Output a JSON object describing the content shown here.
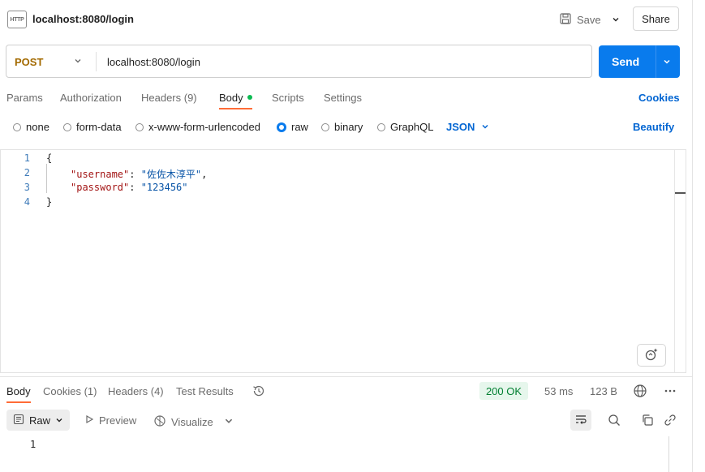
{
  "header": {
    "icon_text": "HTTP",
    "title": "localhost:8080/login",
    "save_label": "Save",
    "share_label": "Share"
  },
  "request": {
    "method": "POST",
    "url": "localhost:8080/login",
    "send_label": "Send"
  },
  "request_tabs": {
    "params": "Params",
    "authorization": "Authorization",
    "headers": "Headers (9)",
    "body": "Body",
    "scripts": "Scripts",
    "settings": "Settings",
    "cookies": "Cookies"
  },
  "body_types": {
    "none": "none",
    "form_data": "form-data",
    "urlencoded": "x-www-form-urlencoded",
    "raw": "raw",
    "binary": "binary",
    "graphql": "GraphQL",
    "format": "JSON",
    "beautify": "Beautify",
    "selected": "raw"
  },
  "editor": {
    "lines": [
      {
        "n": "1",
        "text": "{"
      },
      {
        "n": "2",
        "key": "\"username\"",
        "sep": ": ",
        "value": "\"佐佐木淳平\"",
        "tail": ","
      },
      {
        "n": "3",
        "key": "\"password\"",
        "sep": ": ",
        "value": "\"123456\"",
        "tail": ""
      },
      {
        "n": "4",
        "text": "}"
      }
    ]
  },
  "response_tabs": {
    "body": "Body",
    "cookies": "Cookies (1)",
    "headers": "Headers (4)",
    "test_results": "Test Results"
  },
  "response_meta": {
    "status": "200 OK",
    "time": "53 ms",
    "size": "123 B"
  },
  "response_toolbar": {
    "raw": "Raw",
    "preview": "Preview",
    "visualize": "Visualize"
  },
  "response_body": {
    "line_number": "1"
  },
  "colors": {
    "accent": "#097bed",
    "tab_active": "#ff6c37",
    "method": "#a36a00",
    "status_bg": "#e6f6ec",
    "status_fg": "#007f31"
  }
}
